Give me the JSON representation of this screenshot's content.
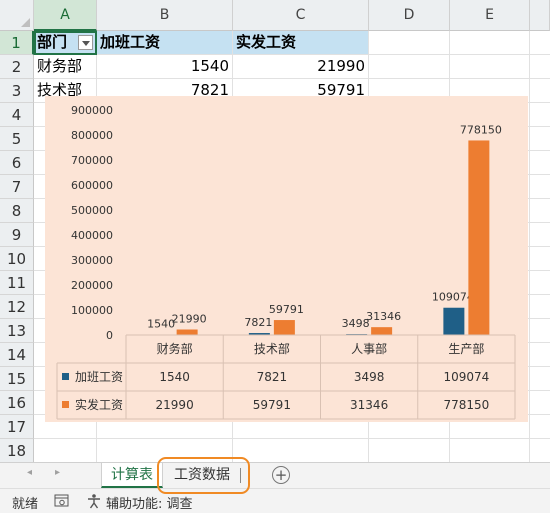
{
  "columns": [
    "A",
    "B",
    "C",
    "D",
    "E"
  ],
  "rows": [
    "1",
    "2",
    "3",
    "4",
    "5",
    "6",
    "7",
    "8",
    "9",
    "10",
    "11",
    "12",
    "13",
    "14",
    "15",
    "16",
    "17",
    "18"
  ],
  "table": {
    "headers": [
      "部门",
      "加班工资",
      "实发工资"
    ],
    "data": [
      [
        "财务部",
        "1540",
        "21990"
      ],
      [
        "技术部",
        "7821",
        "59791"
      ]
    ]
  },
  "chart_data": {
    "type": "bar",
    "categories": [
      "财务部",
      "技术部",
      "人事部",
      "生产部"
    ],
    "series": [
      {
        "name": "加班工资",
        "color": "#1f5f87",
        "values": [
          1540,
          7821,
          3498,
          109074
        ]
      },
      {
        "name": "实发工资",
        "color": "#ed7d31",
        "values": [
          21990,
          59791,
          31346,
          778150
        ]
      }
    ],
    "yticks": [
      "0",
      "100000",
      "200000",
      "300000",
      "400000",
      "500000",
      "600000",
      "700000",
      "800000",
      "900000"
    ],
    "ylim": [
      0,
      900000
    ],
    "data_table": true
  },
  "tabs": {
    "nav_prev": "◂",
    "nav_next": "▸",
    "sheets": [
      "计算表",
      "工资数据"
    ],
    "add": "+"
  },
  "status": {
    "ready": "就绪",
    "accessibility": "辅助功能: 调查"
  }
}
